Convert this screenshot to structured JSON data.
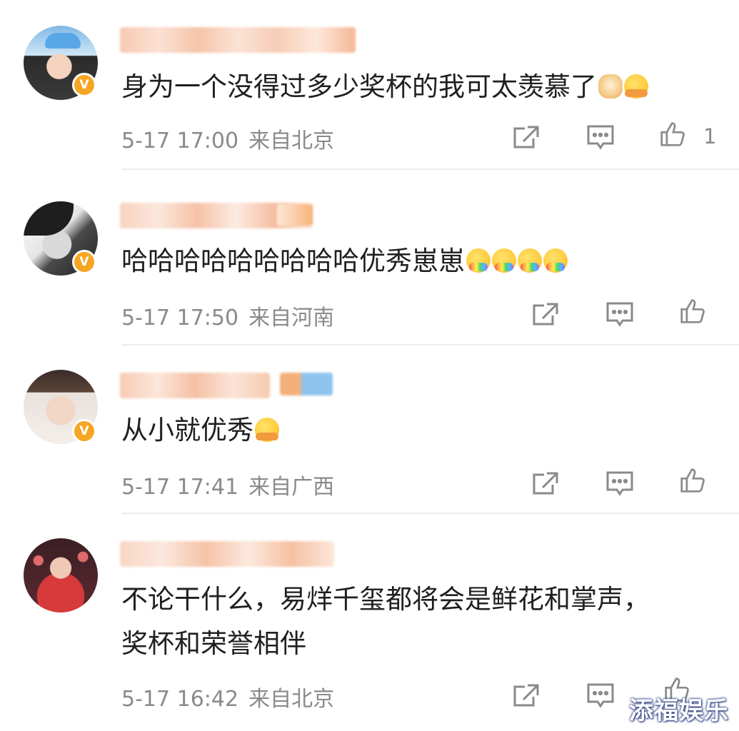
{
  "comments": [
    {
      "text": "身为一个没得过多少奖杯的我可太羡慕了",
      "emojis": [
        "dog",
        "hands"
      ],
      "time": "5-17 17:00",
      "location": "来自北京",
      "like_count": "1"
    },
    {
      "text": "哈哈哈哈哈哈哈哈哈优秀崽崽",
      "emojis": [
        "rainbow",
        "rainbow",
        "rainbow",
        "rainbow"
      ],
      "time": "5-17 17:50",
      "location": "来自河南",
      "like_count": ""
    },
    {
      "text": "从小就优秀",
      "emojis": [
        "hands"
      ],
      "time": "5-17 17:41",
      "location": "来自广西",
      "like_count": ""
    },
    {
      "text_line1": "不论干什么，易烊千玺都将会是鲜花和掌声，",
      "text_line2": "奖杯和荣誉相伴",
      "time": "5-17 16:42",
      "location": "来自北京",
      "like_count": ""
    }
  ],
  "verified_badge": "V",
  "watermark": "添福娱乐",
  "colors": {
    "accent_badge": "#f5a623",
    "meta_text": "#8a8a8a",
    "body_text": "#1f1f1f",
    "divider": "#ececec"
  },
  "icons": [
    "share-icon",
    "comment-icon",
    "like-icon"
  ]
}
